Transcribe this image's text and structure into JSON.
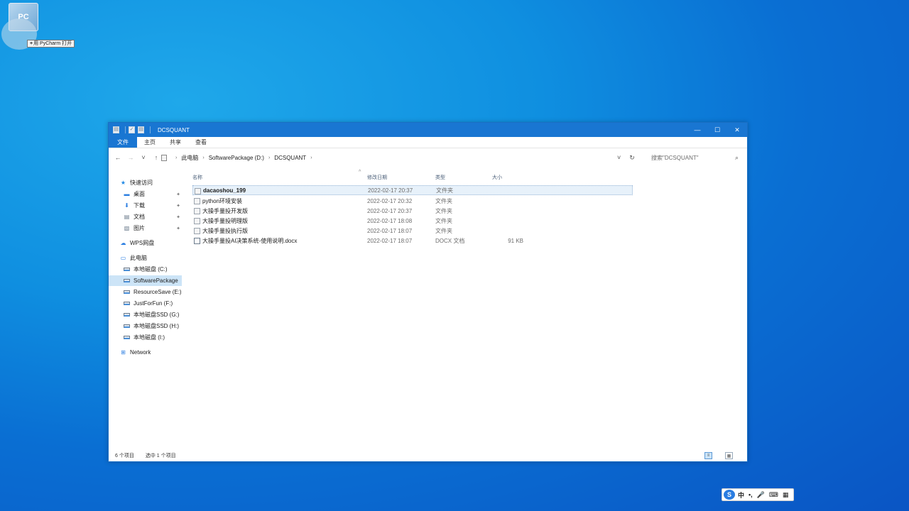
{
  "desktop": {
    "icon_label": "PC",
    "tooltip_prefix": "+",
    "tooltip_text": "用 PyCharm 打开"
  },
  "window": {
    "title": "DCSQUANT",
    "quick_access": [
      "▤",
      "✓",
      "▤"
    ],
    "controls": {
      "minimize": "—",
      "maximize": "☐",
      "close": "✕"
    }
  },
  "ribbon": {
    "tabs": [
      "文件",
      "主页",
      "共享",
      "查看"
    ]
  },
  "navbar": {
    "back": "←",
    "forward": "→",
    "recent": "˅",
    "up": "↑",
    "path": [
      "此电脑",
      "SoftwarePackage (D:)",
      "DCSQUANT"
    ],
    "path_sep": "›",
    "dropdown": "˅",
    "refresh": "↻",
    "search_placeholder": "搜索\"DCSQUANT\"",
    "search_icon": "⌕"
  },
  "sidebar": {
    "quick_access": "快速访问",
    "pinned": [
      {
        "label": "桌面",
        "icon": "desktop-icon"
      },
      {
        "label": "下载",
        "icon": "download-icon"
      },
      {
        "label": "文档",
        "icon": "document-icon"
      },
      {
        "label": "图片",
        "icon": "picture-icon"
      }
    ],
    "pin_glyph": "✦",
    "wps": "WPS网盘",
    "this_pc": "此电脑",
    "drives": [
      "本地磁盘 (C:)",
      "SoftwarePackage",
      "ResourceSave (E:)",
      "JustForFun (F:)",
      "本地磁盘SSD (G:)",
      "本地磁盘SSD (H:)",
      "本地磁盘 (I:)"
    ],
    "network": "Network"
  },
  "list": {
    "columns": {
      "name": "名称",
      "date": "修改日期",
      "type": "类型",
      "size": "大小"
    },
    "sort_arrow": "^",
    "rows": [
      {
        "name": "dacaoshou_199",
        "date": "2022-02-17 20:37",
        "type": "文件夹",
        "size": "",
        "kind": "folder"
      },
      {
        "name": "python环境安装",
        "date": "2022-02-17 20:32",
        "type": "文件夹",
        "size": "",
        "kind": "folder"
      },
      {
        "name": "大操手量投开发版",
        "date": "2022-02-17 20:37",
        "type": "文件夹",
        "size": "",
        "kind": "folder"
      },
      {
        "name": "大操手量投明理版",
        "date": "2022-02-17 18:08",
        "type": "文件夹",
        "size": "",
        "kind": "folder"
      },
      {
        "name": "大操手量投执行版",
        "date": "2022-02-17 18:07",
        "type": "文件夹",
        "size": "",
        "kind": "folder"
      },
      {
        "name": "大操手量投AI决策系统-使用说明.docx",
        "date": "2022-02-17 18:07",
        "type": "DOCX 文档",
        "size": "91 KB",
        "kind": "doc"
      }
    ]
  },
  "status": {
    "count": "6 个项目",
    "selected": "选中 1 个项目"
  },
  "ime": {
    "logo": "S",
    "items": [
      "中",
      "•,",
      "🎤",
      "⌨",
      "▦"
    ]
  }
}
